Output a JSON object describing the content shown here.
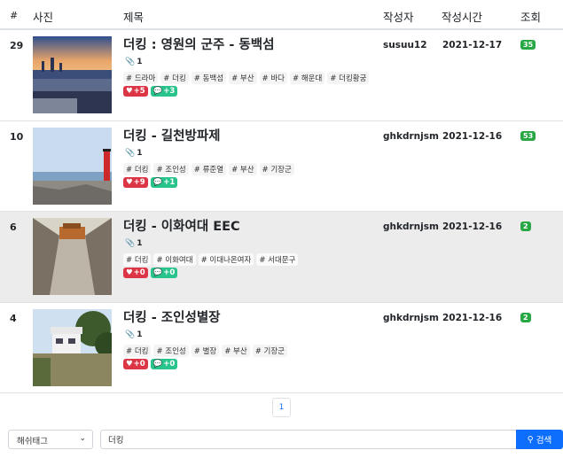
{
  "table": {
    "headers": {
      "num": "#",
      "photo": "사진",
      "title": "제목",
      "author": "작성자",
      "time": "작성시간",
      "views": "조회"
    },
    "rows": [
      {
        "num": "29",
        "title": "더킹 : 영원의 군주 - 동백섬",
        "attachments": "1",
        "tags": [
          "# 드라마",
          "# 더킹",
          "# 동백섬",
          "# 부산",
          "# 바다",
          "# 해운대",
          "# 더킹황궁"
        ],
        "likes": "+5",
        "comments": "+3",
        "author": "susuu12",
        "date": "2021-12-17",
        "views": "35"
      },
      {
        "num": "10",
        "title": "더킹 - 길천방파제",
        "attachments": "1",
        "tags": [
          "# 더킹",
          "# 조인성",
          "# 류준열",
          "# 부산",
          "# 기장군"
        ],
        "likes": "+9",
        "comments": "+1",
        "author": "ghkdrnjsm",
        "date": "2021-12-16",
        "views": "53"
      },
      {
        "num": "6",
        "title": "더킹 - 이화여대 EEC",
        "attachments": "1",
        "tags": [
          "# 더킹",
          "# 이화여대",
          "# 이대나온여자",
          "# 서대문구"
        ],
        "likes": "+0",
        "comments": "+0",
        "author": "ghkdrnjsm",
        "date": "2021-12-16",
        "views": "2"
      },
      {
        "num": "4",
        "title": "더킹 - 조인성별장",
        "attachments": "1",
        "tags": [
          "# 더킹",
          "# 조인성",
          "# 별장",
          "# 부산",
          "# 기장군"
        ],
        "likes": "+0",
        "comments": "+0",
        "author": "ghkdrnjsm",
        "date": "2021-12-16",
        "views": "2"
      }
    ]
  },
  "pagination": {
    "current": "1"
  },
  "search": {
    "select_value": "해쉬태그",
    "input_value": "더킹",
    "button_label": "검색"
  },
  "colors": {
    "like": "#dc3545",
    "comment": "#28c48c",
    "views": "#28a745",
    "primary": "#0d6efd"
  }
}
